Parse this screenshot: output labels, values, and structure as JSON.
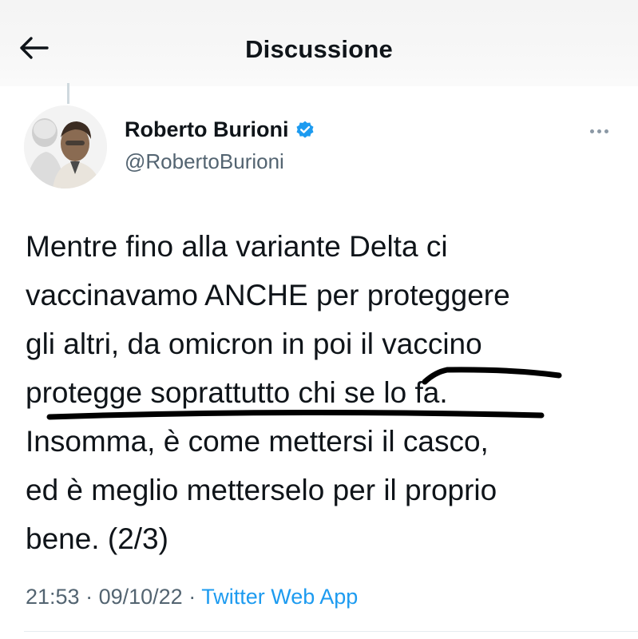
{
  "header": {
    "title": "Discussione"
  },
  "tweet": {
    "author": {
      "display_name": "Roberto Burioni",
      "handle": "@RobertoBurioni",
      "verified": true
    },
    "text_lines": [
      "Mentre fino alla variante Delta ci",
      "vaccinavamo ANCHE per proteggere",
      "gli altri, da omicron in poi il vaccino",
      "protegge soprattutto chi se lo fa.",
      "Insomma, è come mettersi il casco,",
      "ed è meglio metterselo per il proprio",
      "bene. (2/3)"
    ],
    "time": "21:53",
    "date": "09/10/22",
    "source": "Twitter Web App"
  },
  "colors": {
    "text": "#0f1419",
    "secondary": "#536471",
    "link": "#1d9bf0",
    "verified_badge": "#1d9bf0",
    "scribble": "#000000"
  },
  "icons": [
    "back-arrow-icon",
    "verified-badge-icon",
    "more-options-icon"
  ]
}
